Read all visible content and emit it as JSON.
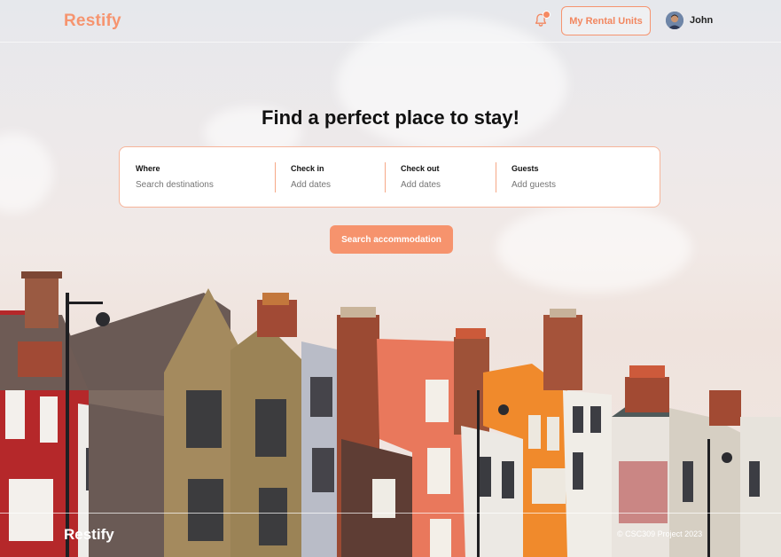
{
  "header": {
    "logo": "Restify",
    "rental_button": "My Rental Units",
    "user_name": "John"
  },
  "hero": {
    "title": "Find a perfect place to stay!"
  },
  "search": {
    "fields": [
      {
        "label": "Where",
        "placeholder": "Search destinations"
      },
      {
        "label": "Check in",
        "placeholder": "Add dates"
      },
      {
        "label": "Check out",
        "placeholder": "Add dates"
      },
      {
        "label": "Guests",
        "placeholder": "Add guests"
      }
    ],
    "button": "Search accommodation"
  },
  "footer": {
    "logo": "Restify",
    "copyright": "© CSC309 Project 2023"
  },
  "colors": {
    "accent": "#f6946f",
    "border": "#f6b49a"
  }
}
